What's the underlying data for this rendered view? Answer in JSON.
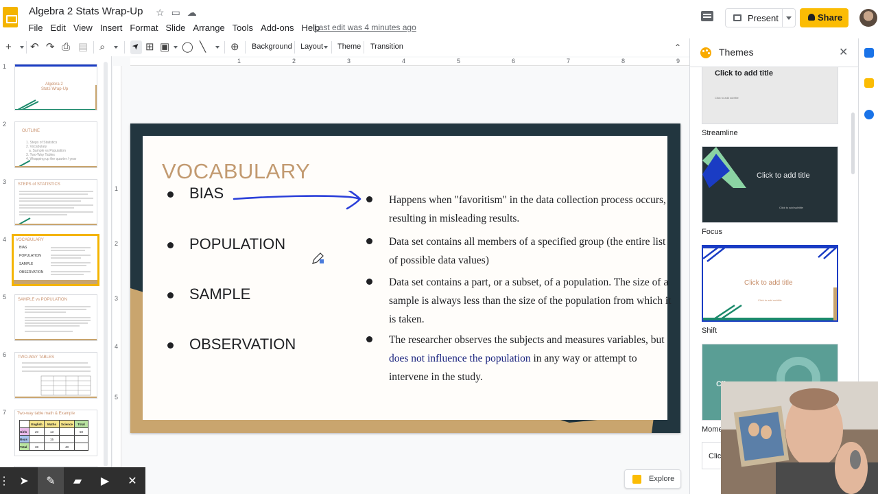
{
  "app": {
    "title": "Algebra 2  Stats Wrap-Up",
    "last_edit": "Last edit was 4 minutes ago",
    "menu": [
      "File",
      "Edit",
      "View",
      "Insert",
      "Format",
      "Slide",
      "Arrange",
      "Tools",
      "Add-ons",
      "Help"
    ],
    "present_label": "Present",
    "share_label": "Share"
  },
  "toolbar": {
    "background_label": "Background",
    "layout_label": "Layout",
    "theme_label": "Theme",
    "transition_label": "Transition"
  },
  "ruler": {
    "h_ticks": [
      "1",
      "2",
      "3",
      "4",
      "5",
      "6",
      "7",
      "8",
      "9"
    ],
    "v_ticks": [
      "1",
      "2",
      "3",
      "4",
      "5"
    ]
  },
  "thumbnails": [
    {
      "num": "1",
      "title": "Algebra 2",
      "subtitle": "Stats Wrap-Up"
    },
    {
      "num": "2",
      "title": "OUTLINE",
      "lines": [
        "1. Steps of Statistics",
        "2. Vocabulary",
        "a. Sample vs Population",
        "3. Two-Way Tables",
        "4. Wrapping up the quarter / year"
      ]
    },
    {
      "num": "3",
      "title": "STEPS of STATISTICS"
    },
    {
      "num": "4",
      "title": "VOCABULARY",
      "items": [
        "BIAS",
        "POPULATION",
        "SAMPLE",
        "OBSERVATION"
      ]
    },
    {
      "num": "5",
      "title": "SAMPLE vs POPULATION"
    },
    {
      "num": "6",
      "title": "TWO-WAY TABLES"
    },
    {
      "num": "7",
      "title": "Two-way table math & Example",
      "headers": [
        "",
        "English",
        "Maths",
        "Science",
        "Total"
      ],
      "rows": [
        [
          "Girls",
          "20",
          "13",
          "",
          "50"
        ],
        [
          "Boys",
          "",
          "15",
          "",
          ""
        ],
        [
          "Total",
          "38",
          "",
          "40",
          ""
        ]
      ]
    }
  ],
  "slide": {
    "heading": "VOCABULARY",
    "terms": [
      "BIAS",
      "POPULATION",
      "SAMPLE",
      "OBSERVATION"
    ],
    "definitions": [
      {
        "text": "Happens when \"favoritism\" in the data collection process occurs, resulting in misleading results."
      },
      {
        "text": "Data set contains all members of a specified group (the entire list of possible data values)"
      },
      {
        "text": "Data set contains a part, or a subset, of a population. The size of a sample is always less than the size of the population from which it is taken."
      },
      {
        "pre": "The researcher observes the subjects and measures variables, but ",
        "highlight": "does not influence the population",
        "post": " in any way or attempt to intervene in the study."
      }
    ]
  },
  "themes_panel": {
    "title": "Themes",
    "themes": [
      {
        "name": "Streamline",
        "card_title": "Click to add title",
        "card_sub": "Click to add subtitle"
      },
      {
        "name": "Focus",
        "card_title": "Click to add title",
        "card_sub": "Click to add subtitle"
      },
      {
        "name": "Shift",
        "card_title": "Click to add title",
        "card_sub": "Click to add subtitle"
      },
      {
        "name": "Mome",
        "card_title": "Cli",
        "card_sub": ""
      }
    ],
    "next_card_text": "Clic"
  },
  "explore_label": "Explore",
  "colors": {
    "accent_yellow": "#fbbc04",
    "slide_dark": "#22363f",
    "slide_gold": "#c9a56e",
    "heading_tan": "#c29a70",
    "pen_blue": "#2b3fd9"
  },
  "icons": {
    "pen_toolbar": [
      "menu-grip-icon",
      "cursor-icon",
      "pen-icon",
      "highlighter-icon",
      "camera-icon",
      "close-icon"
    ]
  }
}
